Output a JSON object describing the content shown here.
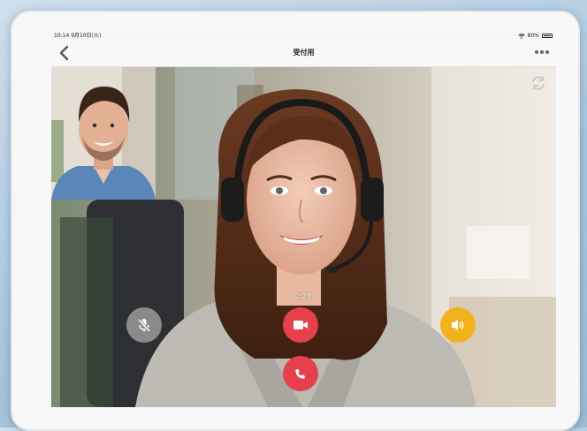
{
  "status_bar": {
    "time_date": "10:14 9月10日(火)",
    "battery": "80%"
  },
  "nav": {
    "title": "受付用"
  },
  "call": {
    "timer": "0:28"
  },
  "colors": {
    "end_call": "#e5404b",
    "camera": "#e5404b",
    "speaker": "#f2b21d",
    "mute": "#8a8a8a"
  },
  "icons": {
    "back": "chevron-left-icon",
    "more": "more-horizontal-icon",
    "rotate": "switch-camera-icon",
    "mute": "mic-off-icon",
    "camera": "video-camera-icon",
    "speaker": "speaker-icon",
    "end_call": "phone-icon"
  }
}
